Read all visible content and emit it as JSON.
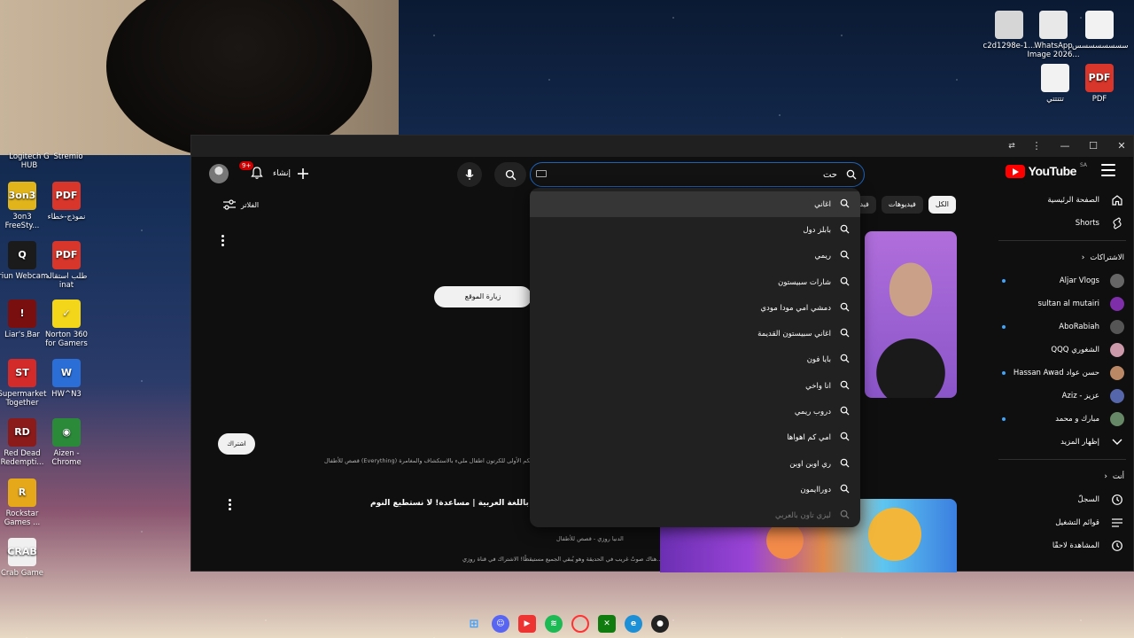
{
  "desktop_icons_left": [
    {
      "label": "Logitech G HUB",
      "glyph": "",
      "color": "#1a1a1a"
    },
    {
      "label": "Stremio",
      "glyph": "",
      "color": "#1a1a1a"
    },
    {
      "label": "3on3 FreeSty...",
      "glyph": "3on3",
      "color": "#e0b41a"
    },
    {
      "label": "نموذج-خطاء",
      "glyph": "PDF",
      "color": "#d9362b"
    },
    {
      "label": "Iriun Webcam",
      "glyph": "Q",
      "color": "#1b1b1b"
    },
    {
      "label": "طلب استقاله inat",
      "glyph": "PDF",
      "color": "#d9362b"
    },
    {
      "label": "Liar's Bar",
      "glyph": "!",
      "color": "#7a0f0f"
    },
    {
      "label": "Norton 360 for Gamers",
      "glyph": "✓",
      "color": "#f3d51a"
    },
    {
      "label": "Supermarket Together",
      "glyph": "ST",
      "color": "#d32a2a"
    },
    {
      "label": "HW^N3",
      "glyph": "W",
      "color": "#2b6fd6"
    },
    {
      "label": "Red Dead Redempti...",
      "glyph": "RD",
      "color": "#8b1a1a"
    },
    {
      "label": "Aizen - Chrome",
      "glyph": "◉",
      "color": "#2a8a3a"
    },
    {
      "label": "Rockstar Games ...",
      "glyph": "R",
      "color": "#e5a81a"
    },
    {
      "label": "Crab Game",
      "glyph": "CRAB",
      "color": "#f0f0f0"
    }
  ],
  "desktop_icons_right": [
    {
      "label": "c2d1298e-1...",
      "glyph": "",
      "color": "#d6d6d6"
    },
    {
      "label": "WhatsApp Image 2026...",
      "glyph": "",
      "color": "#e8e8e8"
    },
    {
      "label": "سسسسسسسس",
      "glyph": "",
      "color": "#f2f2f2"
    },
    {
      "label": "تتتتتي",
      "glyph": "",
      "color": "#f2f2f2"
    },
    {
      "label": "PDF",
      "glyph": "PDF",
      "color": "#d9362b"
    }
  ],
  "youtube": {
    "logo_text": "YouTube",
    "region": "SA",
    "search_value": "حت",
    "create_label": "إنشاء",
    "notification_count": "9+",
    "filter_label": "الفلاتر",
    "chips": [
      "الكل",
      "فيديوهات",
      "فيديو"
    ],
    "sidebar": {
      "items": [
        {
          "label": "الصفحة الرئيسية",
          "icon": "home-icon"
        },
        {
          "label": "Shorts",
          "icon": "shorts-icon"
        }
      ],
      "subscriptions_label": "الاشتراكات",
      "subscriptions": [
        {
          "label": "Aljar Vlogs",
          "dot": true,
          "color": "#666"
        },
        {
          "label": "sultan al mutairi",
          "dot": false,
          "color": "#7d2ea8"
        },
        {
          "label": "AboRabiah",
          "dot": true,
          "color": "#555"
        },
        {
          "label": "الشغوري QQQ",
          "dot": false,
          "color": "#c9a"
        },
        {
          "label": "حسن عواد Hassan Awad",
          "dot": true,
          "color": "#b86"
        },
        {
          "label": "عزيز - Aziz",
          "dot": false,
          "color": "#56a"
        },
        {
          "label": "مبارك و محمد",
          "dot": true,
          "color": "#686"
        }
      ],
      "show_more": "إظهار المزيد",
      "you_label": "أنت",
      "you_items": [
        {
          "label": "السجلّ",
          "icon": "history-icon"
        },
        {
          "label": "قوائم التشغيل",
          "icon": "playlist-icon"
        },
        {
          "label": "المشاهدة لاحقًا",
          "icon": "watch-later-icon"
        }
      ]
    },
    "visit_site_label": "زيارة الموقع",
    "subscribe_label": "اشتراك",
    "ad_description": "قصص للأطفال (Everything) وجهتكم الأولى للكرتون اطفال مليء بالاستكشاف والمغامرة...",
    "video_title": "قصص أطفال باللغة العربية | مساعدة! لا نستطيع النوم!",
    "video_channel": "الدنيا روزي - قصص للأطفال",
    "video_desc": "هناك صوتٌ غريب في الحديقة وهو يُبقي الجميع مستيقظًا! الاشتراك في قناة روزي...",
    "suggestions": [
      "اغاني",
      "بابلز دول",
      "ريمي",
      "شارات سبيستون",
      "دمشي امي مودا مودي",
      "اغاني سبيستون القديمة",
      "بايا فون",
      "انا واخي",
      "دروب ريمي",
      "امي كم اهواها",
      "ري اوبن اوبن",
      "دوراايمون",
      "ليزي تاون بالعربي"
    ]
  }
}
